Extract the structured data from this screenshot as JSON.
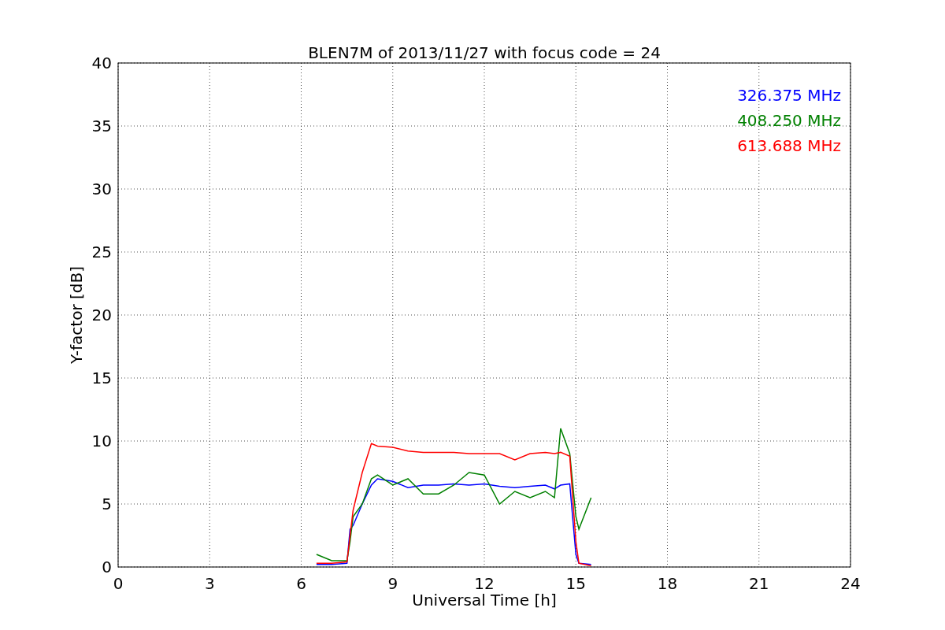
{
  "figure": {
    "chart_data": {
      "type": "line",
      "title": "BLEN7M of 2013/11/27 with focus code = 24",
      "xlabel": "Universal Time [h]",
      "ylabel": "Y-factor [dB]",
      "x": [
        6.5,
        7,
        7.5,
        7.6,
        7.7,
        8,
        8.3,
        8.5,
        9,
        9.5,
        10,
        10.5,
        11,
        11.5,
        12,
        12.5,
        13,
        13.5,
        14,
        14.3,
        14.5,
        14.8,
        15,
        15.1,
        15.5
      ],
      "series": [
        {
          "name": "326.375 MHz",
          "color": "#0000ff",
          "values": [
            0.2,
            0.2,
            0.3,
            3,
            3.3,
            5,
            6.5,
            7,
            6.8,
            6.3,
            6.5,
            6.5,
            6.6,
            6.5,
            6.6,
            6.4,
            6.3,
            6.4,
            6.5,
            6.2,
            6.5,
            6.6,
            1,
            0.3,
            0.2
          ]
        },
        {
          "name": "408.250 MHz",
          "color": "#008000",
          "values": [
            1,
            0.5,
            0.5,
            2,
            4,
            5,
            7,
            7.3,
            6.5,
            7,
            5.8,
            5.8,
            6.5,
            7.5,
            7.3,
            5,
            6,
            5.5,
            6,
            5.5,
            11,
            9,
            4,
            3,
            5.5
          ]
        },
        {
          "name": "613.688 MHz",
          "color": "#ff0000",
          "values": [
            0.3,
            0.3,
            0.4,
            2.5,
            4.5,
            7.5,
            9.8,
            9.6,
            9.5,
            9.2,
            9.1,
            9.1,
            9.1,
            9,
            9,
            9,
            8.5,
            9,
            9.1,
            9,
            9.1,
            8.8,
            2,
            0.3,
            0.1
          ]
        }
      ],
      "xlim": [
        0,
        24
      ],
      "ylim": [
        0,
        40
      ],
      "xticks": [
        0,
        3,
        6,
        9,
        12,
        15,
        18,
        21,
        24
      ],
      "yticks": [
        0,
        5,
        10,
        15,
        20,
        25,
        30,
        35,
        40
      ],
      "grid": true
    }
  }
}
